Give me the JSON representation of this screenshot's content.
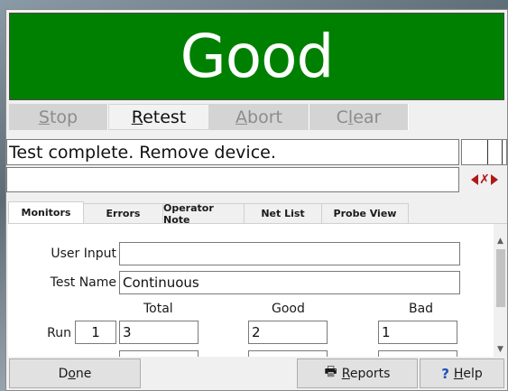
{
  "status": {
    "text": "Good",
    "color": "#008000"
  },
  "controls": [
    {
      "label": "Stop",
      "accel": "S",
      "rest": "top",
      "state": "disabled"
    },
    {
      "label": "Retest",
      "accel": "R",
      "rest": "etest",
      "state": "active"
    },
    {
      "label": "Abort",
      "accel": "A",
      "rest": "bort",
      "state": "disabled"
    },
    {
      "label": "Clear",
      "accel": "Cl",
      "accel_pre": "C",
      "accel_u": "l",
      "rest": "ear",
      "state": "disabled"
    }
  ],
  "message": {
    "line1": "Test complete. Remove device.",
    "line2": ""
  },
  "nav_icon": "prev-stop-next-icon",
  "tabs": [
    {
      "label": "Monitors",
      "selected": true
    },
    {
      "label": "Errors",
      "selected": false
    },
    {
      "label": "Operator Note",
      "selected": false
    },
    {
      "label": "Net List",
      "selected": false
    },
    {
      "label": "Probe View",
      "selected": false
    }
  ],
  "monitors": {
    "user_input_label": "User Input",
    "user_input_value": "",
    "test_name_label": "Test Name",
    "test_name_value": "Continuous",
    "columns": [
      "Total",
      "Good",
      "Bad"
    ],
    "run_label": "Run",
    "run_number": "1",
    "run_values": [
      "3",
      "2",
      "1"
    ]
  },
  "bottom": {
    "done": {
      "pre": "D",
      "accel": "o",
      "rest": "ne"
    },
    "reports": {
      "pre": "",
      "accel": "R",
      "rest": "eports"
    },
    "help": {
      "pre": "",
      "accel": "H",
      "rest": "elp"
    }
  }
}
